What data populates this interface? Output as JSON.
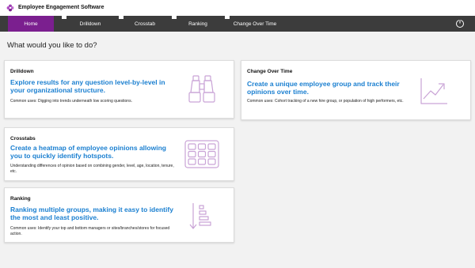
{
  "app": {
    "title": "Employee Engagement Software",
    "logo_icon": "flower-logo-icon",
    "accent_color": "#7b1f8f",
    "link_color": "#1a7fd0"
  },
  "nav": {
    "tabs": [
      {
        "label": "Home",
        "active": true
      },
      {
        "label": "Drilldown",
        "active": false
      },
      {
        "label": "Crosstab",
        "active": false
      },
      {
        "label": "Ranking",
        "active": false
      },
      {
        "label": "Change Over Time",
        "active": false
      }
    ],
    "power_icon": "power-icon"
  },
  "main": {
    "question": "What would you like to do?"
  },
  "cards": {
    "drilldown": {
      "title": "Drilldown",
      "description": "Explore results for any question level-by-level in your organizational structure.",
      "uses": "Common uses: Digging into trends underneath low scoring questions.",
      "icon": "binoculars-icon"
    },
    "crosstabs": {
      "title": "Crosstabs",
      "description": "Create a heatmap of employee opinions allowing you to quickly identify hotspots.",
      "uses": "Understanding differences of opinion based on combining gender, level, age, location, tenure, etc.",
      "icon": "grid-heatmap-icon"
    },
    "ranking": {
      "title": "Ranking",
      "description": "Ranking multiple groups, making it easy to identify the most and least positive.",
      "uses": "Common uses: Identify your top and bottom managers or sites/branches/stores for focused action.",
      "icon": "sort-descending-icon"
    },
    "change_over_time": {
      "title": "Change Over Time",
      "description": "Create a unique employee group and track their opinions over time.",
      "uses": "Common uses: Cohort tracking of a new hire group, or population of high performers, etc.",
      "icon": "trend-up-icon"
    }
  }
}
